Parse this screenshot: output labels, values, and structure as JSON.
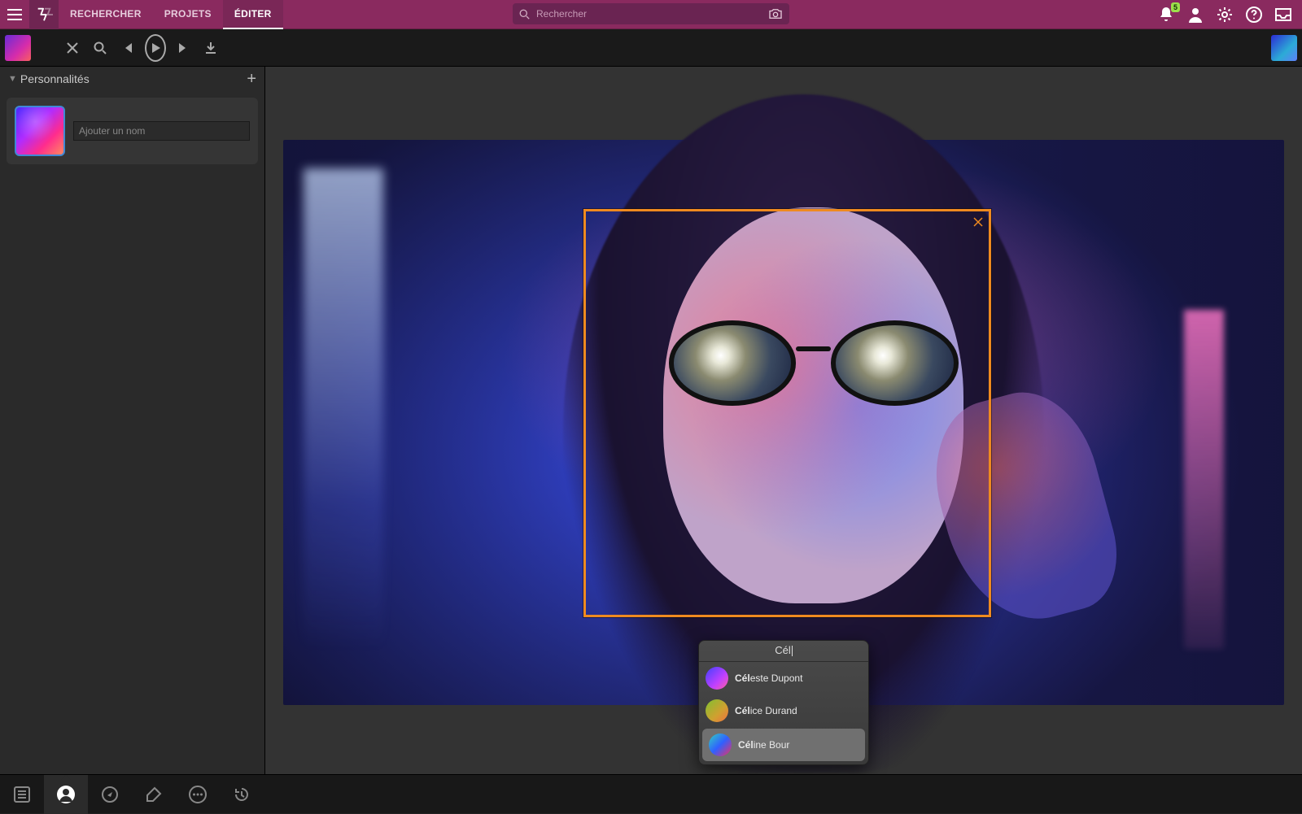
{
  "nav": {
    "tabs": [
      "RECHERCHER",
      "PROJETS",
      "ÉDITER"
    ],
    "active_tab": 2,
    "search_placeholder": "Rechercher",
    "notification_count": "5"
  },
  "sidebar": {
    "section_title": "Personnalités",
    "name_input_placeholder": "Ajouter un nom"
  },
  "face_detection": {
    "autocomplete": {
      "query": "Cél",
      "suggestions": [
        {
          "match": "Cél",
          "rest": "este Dupont",
          "selected": false
        },
        {
          "match": "Cél",
          "rest": "ice Durand",
          "selected": false
        },
        {
          "match": "Cél",
          "rest": "ine Bour",
          "selected": true
        }
      ]
    }
  }
}
